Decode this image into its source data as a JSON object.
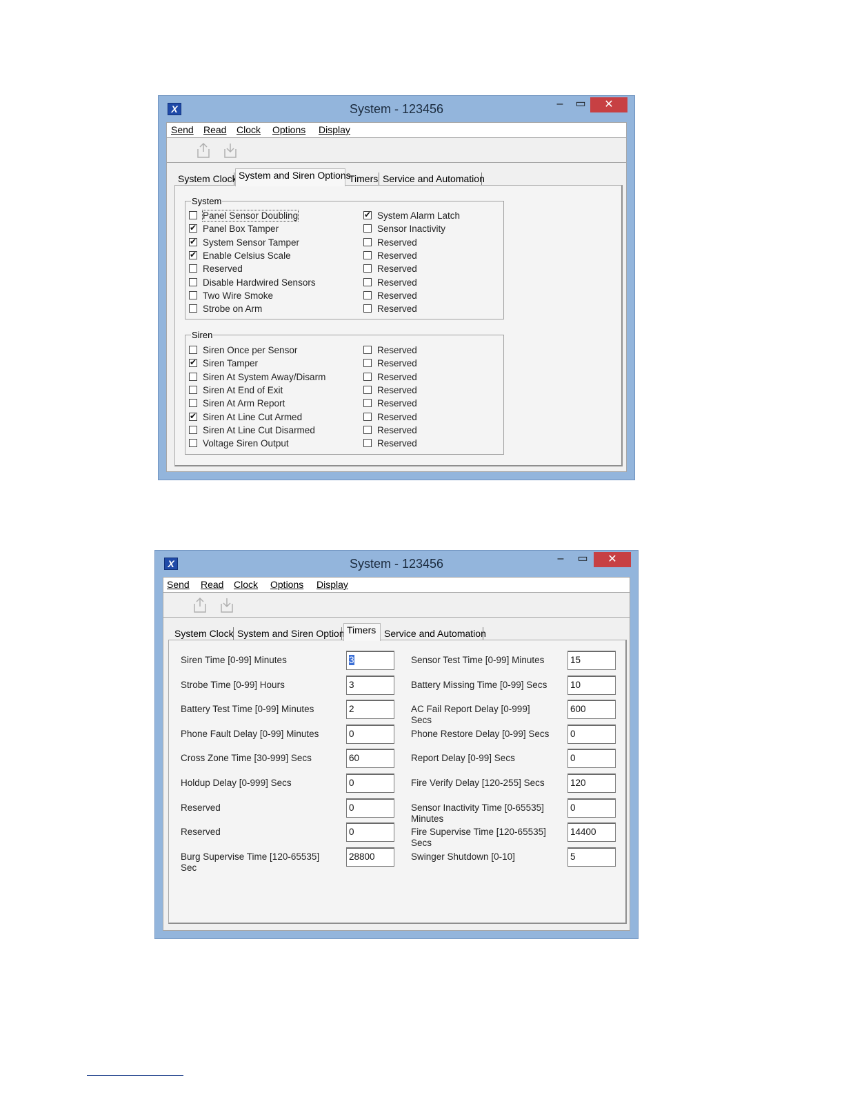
{
  "win1": {
    "title": "System - 123456",
    "menu": [
      "Send",
      "Read",
      "Clock",
      "Options",
      "Display"
    ],
    "tabs": [
      "System Clock",
      "System and Siren Options",
      "Timers",
      "Service and Automation"
    ],
    "active_tab": "System and Siren Options",
    "system_group": {
      "legend": "System",
      "left": [
        {
          "label": "Panel Sensor Doubling",
          "checked": false
        },
        {
          "label": "Panel Box Tamper",
          "checked": true
        },
        {
          "label": "System Sensor Tamper",
          "checked": true
        },
        {
          "label": "Enable Celsius Scale",
          "checked": true
        },
        {
          "label": "Reserved",
          "checked": false
        },
        {
          "label": "Disable Hardwired Sensors",
          "checked": false
        },
        {
          "label": "Two Wire Smoke",
          "checked": false
        },
        {
          "label": "Strobe on Arm",
          "checked": false
        }
      ],
      "right": [
        {
          "label": "System Alarm Latch",
          "checked": true
        },
        {
          "label": "Sensor Inactivity",
          "checked": false
        },
        {
          "label": "Reserved",
          "checked": false
        },
        {
          "label": "Reserved",
          "checked": false
        },
        {
          "label": "Reserved",
          "checked": false
        },
        {
          "label": "Reserved",
          "checked": false
        },
        {
          "label": "Reserved",
          "checked": false
        },
        {
          "label": "Reserved",
          "checked": false
        }
      ]
    },
    "siren_group": {
      "legend": "Siren",
      "left": [
        {
          "label": "Siren Once per Sensor",
          "checked": false
        },
        {
          "label": "Siren Tamper",
          "checked": true
        },
        {
          "label": "Siren At System Away/Disarm",
          "checked": false
        },
        {
          "label": "Siren At End of Exit",
          "checked": false
        },
        {
          "label": "Siren At Arm Report",
          "checked": false
        },
        {
          "label": "Siren At Line Cut Armed",
          "checked": true
        },
        {
          "label": "Siren At Line Cut Disarmed",
          "checked": false
        },
        {
          "label": "Voltage Siren Output",
          "checked": false
        }
      ],
      "right": [
        {
          "label": "Reserved",
          "checked": false
        },
        {
          "label": "Reserved",
          "checked": false
        },
        {
          "label": "Reserved",
          "checked": false
        },
        {
          "label": "Reserved",
          "checked": false
        },
        {
          "label": "Reserved",
          "checked": false
        },
        {
          "label": "Reserved",
          "checked": false
        },
        {
          "label": "Reserved",
          "checked": false
        },
        {
          "label": "Reserved",
          "checked": false
        }
      ]
    }
  },
  "win2": {
    "title": "System - 123456",
    "menu": [
      "Send",
      "Read",
      "Clock",
      "Options",
      "Display"
    ],
    "tabs": [
      "System Clock",
      "System and Siren Options",
      "Timers",
      "Service and Automation"
    ],
    "active_tab": "Timers",
    "left_timers": [
      {
        "label": "Siren Time [0-99] Minutes",
        "value": "3"
      },
      {
        "label": "Strobe Time [0-99] Hours",
        "value": "3"
      },
      {
        "label": "Battery Test Time [0-99] Minutes",
        "value": "2"
      },
      {
        "label": "Phone Fault Delay [0-99] Minutes",
        "value": "0"
      },
      {
        "label": "Cross Zone Time [30-999] Secs",
        "value": "60"
      },
      {
        "label": "Holdup Delay [0-999] Secs",
        "value": "0"
      },
      {
        "label": "Reserved",
        "value": "0"
      },
      {
        "label": "Reserved",
        "value": "0"
      },
      {
        "label": "Burg Supervise Time [120-65535] Sec",
        "value": "28800"
      }
    ],
    "right_timers": [
      {
        "label": "Sensor Test Time [0-99] Minutes",
        "value": "15"
      },
      {
        "label": "Battery Missing Time [0-99] Secs",
        "value": "10"
      },
      {
        "label": "AC Fail Report Delay [0-999] Secs",
        "value": "600"
      },
      {
        "label": "Phone Restore Delay [0-99] Secs",
        "value": "0"
      },
      {
        "label": "Report Delay [0-99] Secs",
        "value": "0"
      },
      {
        "label": "Fire Verify Delay [120-255] Secs",
        "value": "120"
      },
      {
        "label": "Sensor Inactivity Time [0-65535] Minutes",
        "value": "0"
      },
      {
        "label": "Fire Supervise Time [120-65535] Secs",
        "value": "14400"
      },
      {
        "label": "Swinger Shutdown [0-10]",
        "value": "5"
      }
    ]
  }
}
